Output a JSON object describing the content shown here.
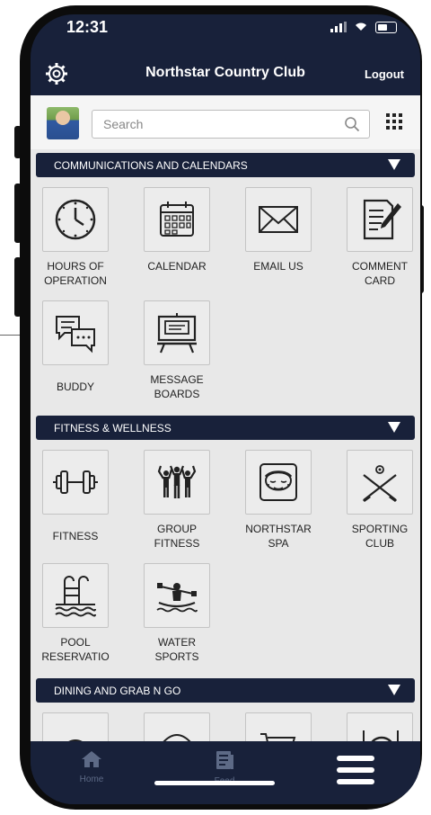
{
  "status": {
    "time": "12:31"
  },
  "header": {
    "title": "Northstar Country Club",
    "logout_label": "Logout"
  },
  "search": {
    "placeholder": "Search"
  },
  "sections": [
    {
      "title": "COMMUNICATIONS AND CALENDARS",
      "tiles": [
        {
          "label": "HOURS OF\nOPERATION",
          "icon": "clock-icon"
        },
        {
          "label": "CALENDAR",
          "icon": "calendar-icon"
        },
        {
          "label": "EMAIL US",
          "icon": "envelope-icon"
        },
        {
          "label": "COMMENT\nCARD",
          "icon": "comment-card-icon"
        },
        {
          "label": "BUDDY",
          "icon": "chat-bubbles-icon"
        },
        {
          "label": "MESSAGE\nBOARDS",
          "icon": "message-board-icon"
        }
      ]
    },
    {
      "title": "FITNESS & WELLNESS",
      "tiles": [
        {
          "label": "FITNESS",
          "icon": "dumbbell-icon"
        },
        {
          "label": "GROUP\nFITNESS",
          "icon": "group-fitness-icon"
        },
        {
          "label": "NORTHSTAR\nSPA",
          "icon": "spa-face-icon"
        },
        {
          "label": "SPORTING\nCLUB",
          "icon": "crossed-rifles-icon"
        },
        {
          "label": "POOL\nRESERVATIO",
          "icon": "pool-ladder-icon"
        },
        {
          "label": "WATER\nSPORTS",
          "icon": "kayak-icon"
        }
      ]
    },
    {
      "title": "DINING AND GRAB N GO",
      "tiles": [
        {
          "label": "",
          "icon": "dining-icon"
        },
        {
          "label": "",
          "icon": "burger-icon"
        },
        {
          "label": "",
          "icon": "cart-icon"
        },
        {
          "label": "",
          "icon": "plate-icon"
        }
      ]
    }
  ],
  "bottom_nav": {
    "home_label": "Home",
    "feed_label": "Feed"
  },
  "colors": {
    "navy": "#18213a",
    "content_bg": "#e8e8e8",
    "pointer_red": "#d12a3c"
  }
}
